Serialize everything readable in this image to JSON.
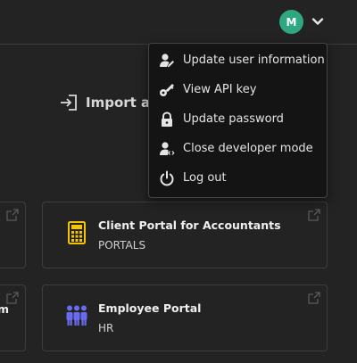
{
  "header": {
    "avatar_initial": "M",
    "avatar_color": "#2fa882"
  },
  "import": {
    "label": "Import ap"
  },
  "cards": [
    {
      "title": "",
      "subtitle": ""
    },
    {
      "title": "Client Portal for Accountants",
      "subtitle": "PORTALS",
      "icon": "calculator-icon",
      "icon_color": "#f2c500"
    },
    {
      "title": "m",
      "subtitle": ""
    },
    {
      "title": "Employee Portal",
      "subtitle": "HR",
      "icon": "people-icon",
      "icon_color": "#6a6cf0"
    }
  ],
  "menu": {
    "items": [
      {
        "label": "Update user information",
        "icon": "user-edit-icon"
      },
      {
        "label": "View API key",
        "icon": "key-icon"
      },
      {
        "label": "Update password",
        "icon": "lock-icon"
      },
      {
        "label": "Close developer mode",
        "icon": "user-code-icon"
      },
      {
        "label": "Log out",
        "icon": "power-icon"
      }
    ]
  }
}
